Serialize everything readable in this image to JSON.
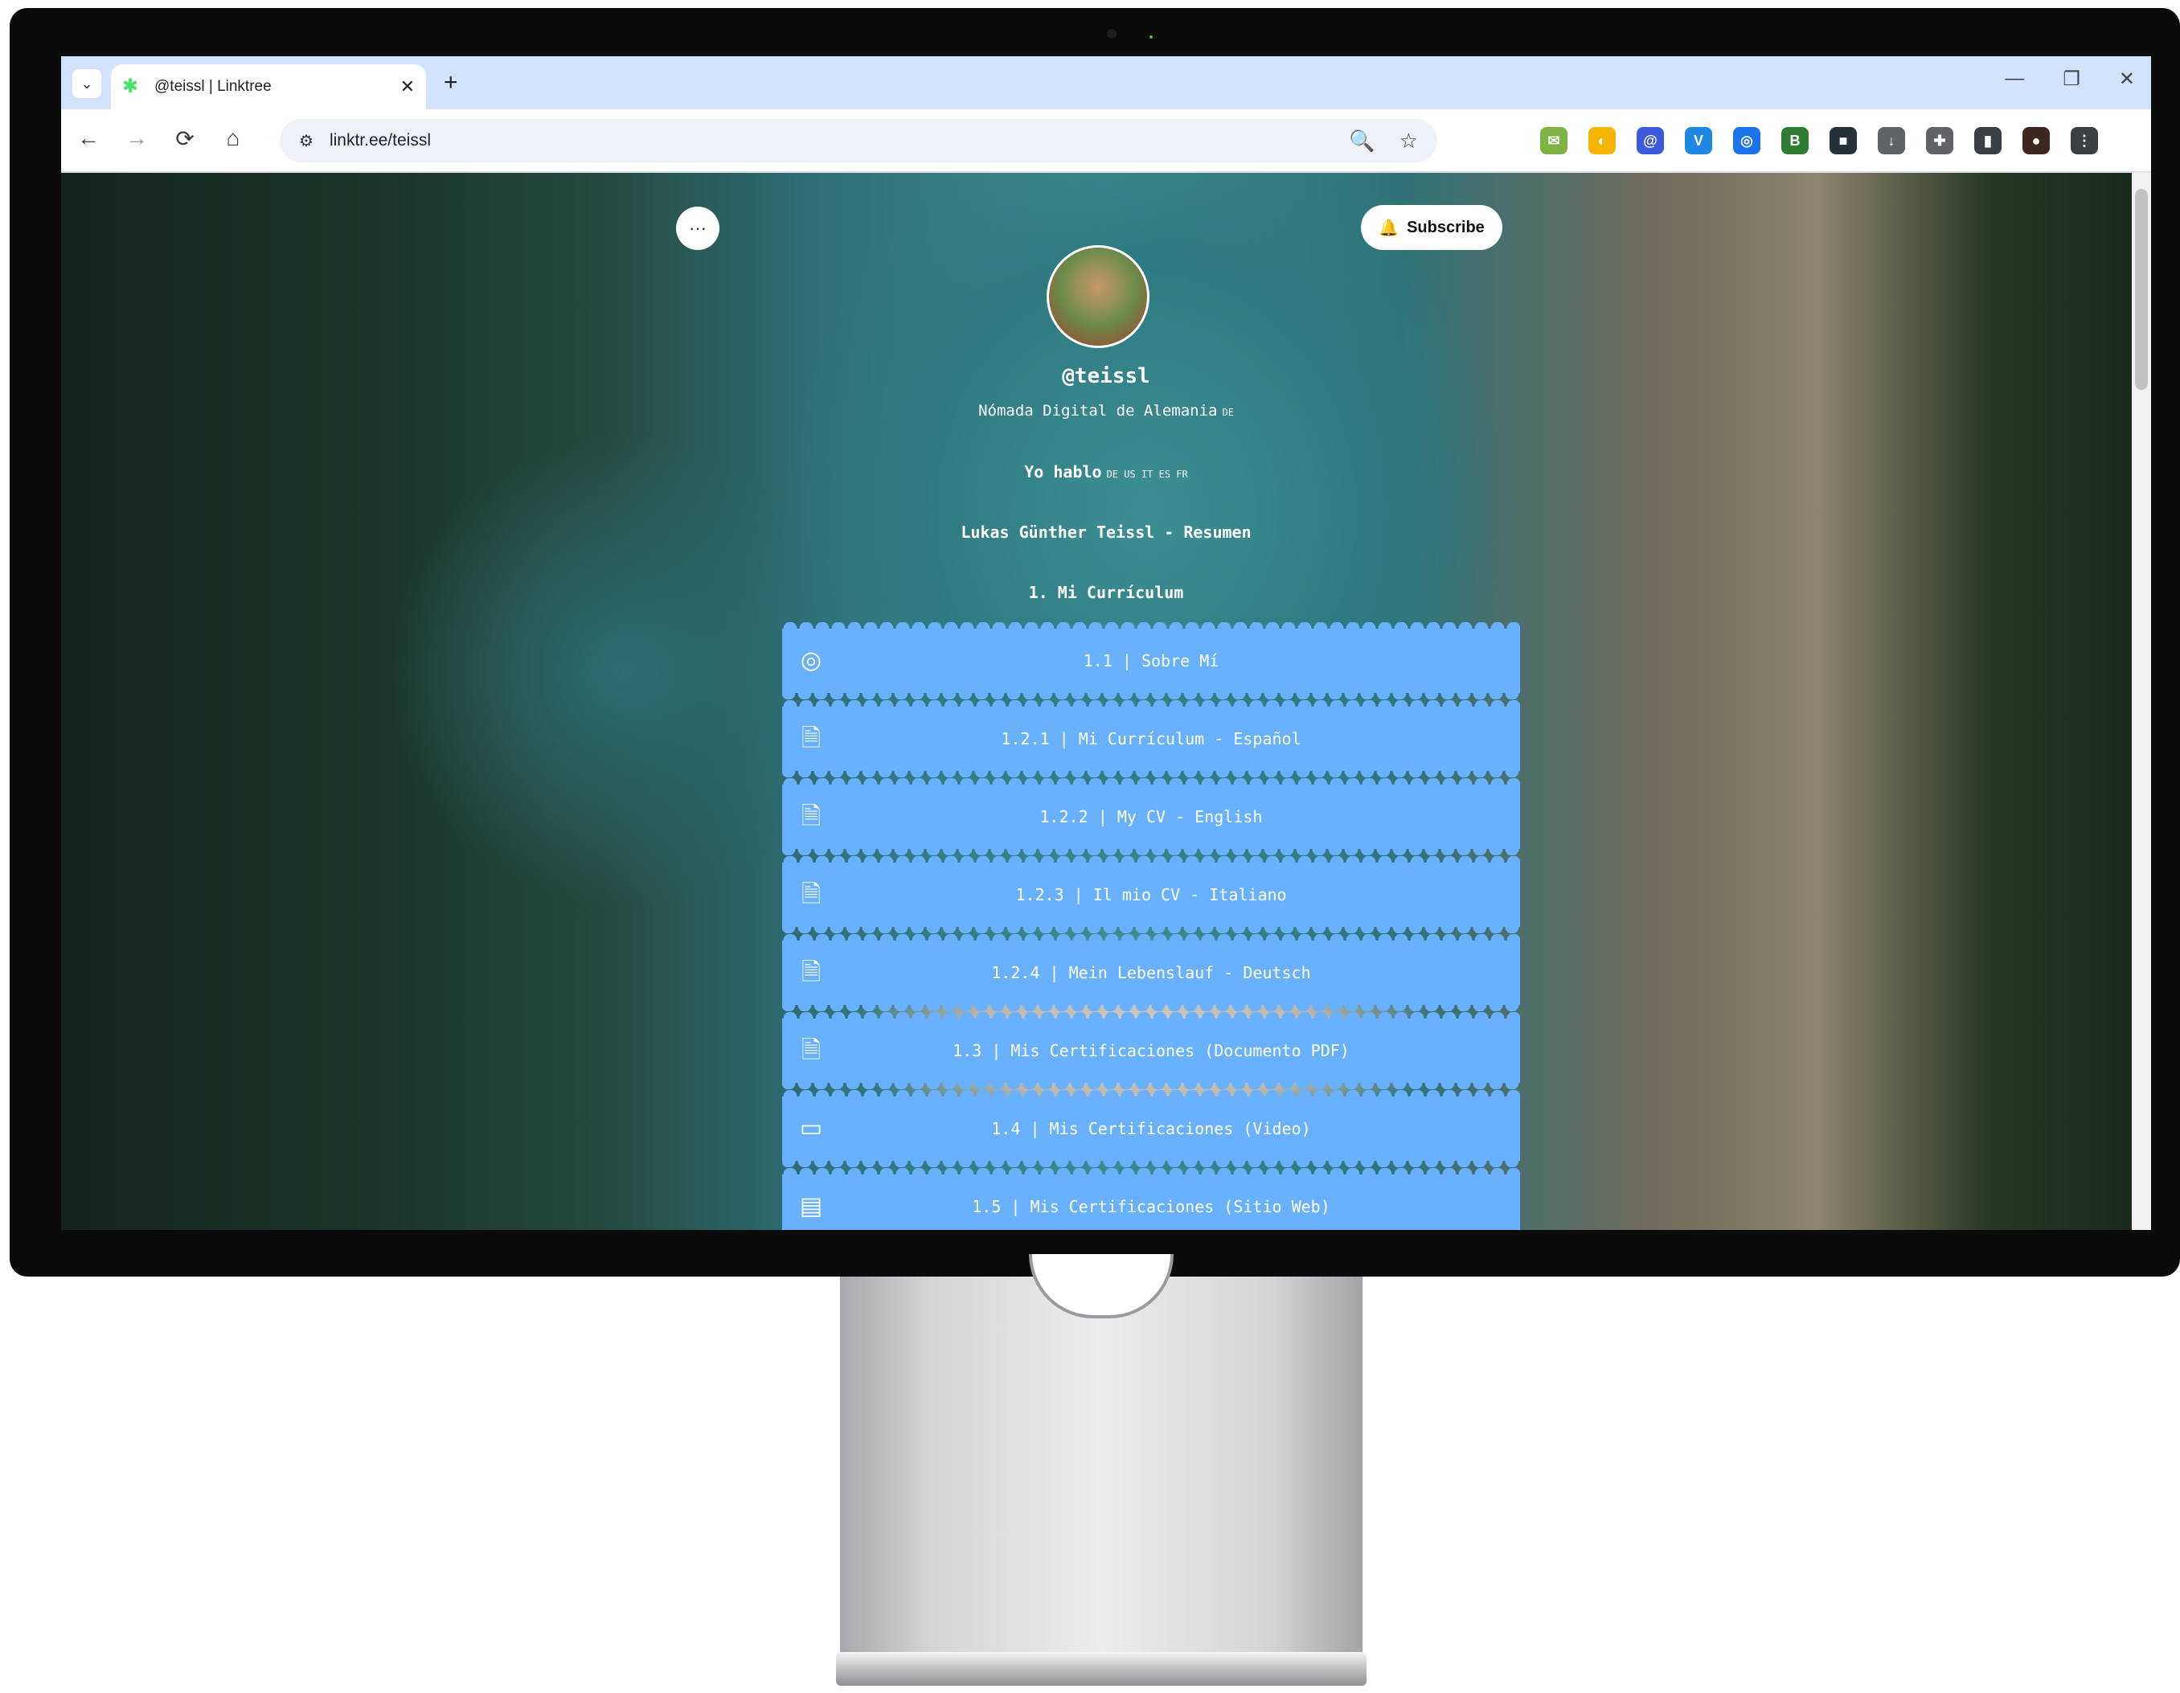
{
  "browser": {
    "tab_title": "@teissl | Linktree",
    "tab_list_icon": "chevron-down-icon",
    "new_tab_label": "+",
    "close_tab_label": "✕",
    "url": "linktr.ee/teissl",
    "window_controls": [
      "—",
      "❐",
      "✕"
    ]
  },
  "toolbar": {
    "back": "←",
    "forward": "→",
    "reload": "⟳",
    "home": "⌂",
    "site_info": "⚙",
    "zoom": "🔍",
    "bookmark": "☆"
  },
  "extensions": [
    {
      "name": "inbox-extension-icon",
      "glyph": "✉",
      "color": "#7cb342"
    },
    {
      "name": "pacman-extension-icon",
      "glyph": "◐",
      "color": "#f4b400"
    },
    {
      "name": "at-extension-icon",
      "glyph": "@",
      "color": "#3b5bdb"
    },
    {
      "name": "vimeo-extension-icon",
      "glyph": "V",
      "color": "#1e88e5"
    },
    {
      "name": "circle-extension-icon",
      "glyph": "◎",
      "color": "#1a73e8"
    },
    {
      "name": "b-extension-icon",
      "glyph": "B",
      "color": "#2e7d32"
    },
    {
      "name": "dark-extension-icon",
      "glyph": "■",
      "color": "#263238"
    },
    {
      "name": "download-icon",
      "glyph": "↓",
      "color": "#5f6368"
    },
    {
      "name": "puzzle-extensions-icon",
      "glyph": "✚",
      "color": "#5f6368"
    },
    {
      "name": "side-panel-icon",
      "glyph": "▮",
      "color": "#3c4043"
    },
    {
      "name": "profile-avatar-icon",
      "glyph": "●",
      "color": "#3e2723"
    },
    {
      "name": "kebab-menu-icon",
      "glyph": "⋮",
      "color": "#3c4043"
    }
  ],
  "page": {
    "more_button": "···",
    "subscribe_label": "Subscribe",
    "handle": "@teissl",
    "bio": "Nómada Digital de Alemania",
    "bio_flag": "DE",
    "langs_prefix": "Yo hablo",
    "langs_flags": "DE US IT ES FR",
    "resumen": "Lukas Günther Teissl - Resumen",
    "section": "1. Mi Currículum"
  },
  "links": [
    {
      "icon": "chrome-icon",
      "glyph": "◎",
      "label": "1.1 | Sobre Mí"
    },
    {
      "icon": "document-icon",
      "glyph": "🗎",
      "label": "1.2.1 | Mi Currículum - Español"
    },
    {
      "icon": "document-icon",
      "glyph": "🗎",
      "label": "1.2.2 | My CV - English"
    },
    {
      "icon": "document-icon",
      "glyph": "🗎",
      "label": "1.2.3 | Il mio CV - Italiano"
    },
    {
      "icon": "document-icon",
      "glyph": "🗎",
      "label": "1.2.4 | Mein Lebenslauf - Deutsch"
    },
    {
      "icon": "document-icon",
      "glyph": "🗎",
      "label": "1.3 | Mis Certificaciones (Documento PDF)"
    },
    {
      "icon": "video-icon",
      "glyph": "▭",
      "label": "1.4 | Mis Certificaciones (Video)"
    },
    {
      "icon": "notebook-icon",
      "glyph": "▤",
      "label": "1.5 | Mis Certificaciones (Sitio Web)"
    }
  ]
}
